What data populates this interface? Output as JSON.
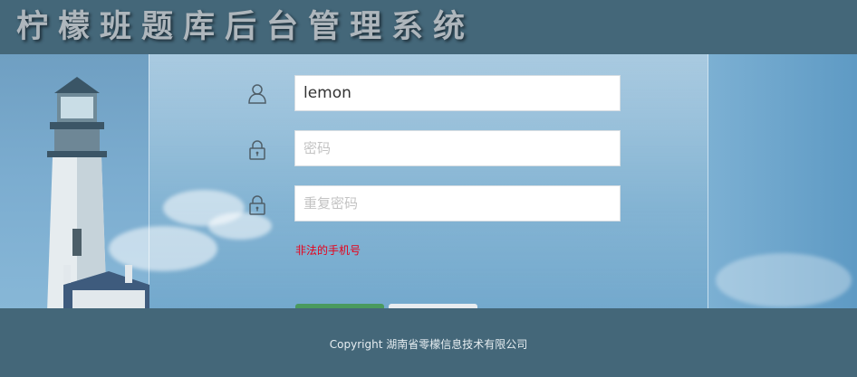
{
  "header": {
    "title": "柠檬班题库后台管理系统"
  },
  "form": {
    "username": {
      "value": "lemon",
      "placeholder": ""
    },
    "password": {
      "value": "",
      "placeholder": "密码"
    },
    "confirm_password": {
      "value": "",
      "placeholder": "重复密码"
    },
    "error_message": "非法的手机号",
    "icons": {
      "username": "user-icon",
      "password": "lock-icon",
      "confirm_password": "lock-icon"
    }
  },
  "footer": {
    "copyright": "Copyright 湖南省零檬信息技术有限公司"
  },
  "colors": {
    "header_bg": "#446779",
    "error": "#e8001a",
    "submit": "#4a9a5e"
  }
}
